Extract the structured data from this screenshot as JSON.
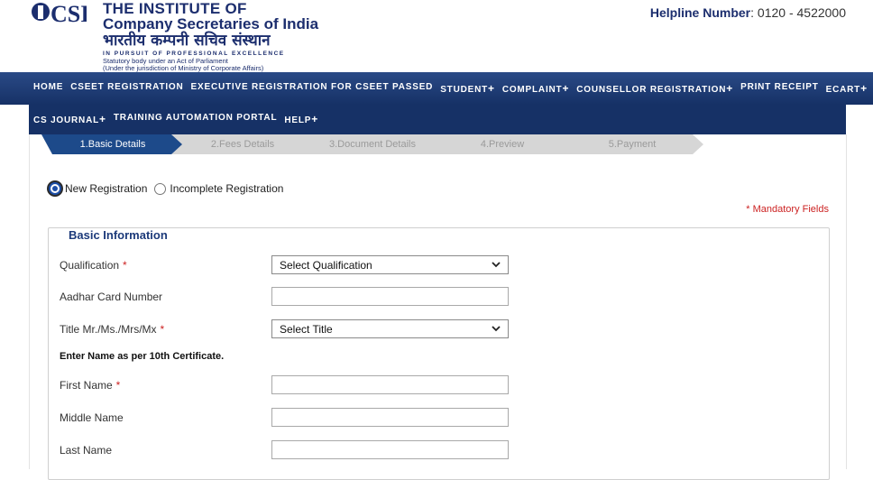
{
  "header": {
    "org_line1": "THE INSTITUTE OF",
    "org_line2": "Company Secretaries of India",
    "org_hindi": "भारतीय कम्पनी सचिव संस्थान",
    "tagline": "IN PURSUIT OF PROFESSIONAL EXCELLENCE",
    "statutory": "Statutory body under an Act of Parliament",
    "jurisdiction": "(Under the jurisdiction of Ministry of Corporate Affairs)",
    "helpline_label": "Helpline Number",
    "helpline_number": ": 0120 - 4522000",
    "logo_icon": "icsi-logo-icon"
  },
  "nav": {
    "row1": [
      {
        "label": "HOME",
        "plus": ""
      },
      {
        "label": "CSEET REGISTRATION",
        "plus": ""
      },
      {
        "label": "EXECUTIVE REGISTRATION FOR CSEET PASSED",
        "plus": ""
      },
      {
        "label": "STUDENT",
        "plus": "+"
      },
      {
        "label": "COMPLAINT",
        "plus": "+"
      },
      {
        "label": "COUNSELLOR REGISTRATION",
        "plus": "+"
      },
      {
        "label": "PRINT RECEIPT",
        "plus": ""
      },
      {
        "label": "ECART",
        "plus": "+"
      }
    ],
    "row2": [
      {
        "label": "CS JOURNAL",
        "plus": "+"
      },
      {
        "label": "TRAINING AUTOMATION PORTAL",
        "plus": ""
      },
      {
        "label": "HELP",
        "plus": "+"
      }
    ]
  },
  "steps": [
    "1.Basic Details",
    "2.Fees Details",
    "3.Document Details",
    "4.Preview",
    "5.Payment"
  ],
  "active_step": 0,
  "registration_type": {
    "options": [
      "New Registration",
      "Incomplete Registration"
    ],
    "selected": "New Registration"
  },
  "mandatory_note": "* Mandatory Fields",
  "section_title": "Basic Information",
  "form": {
    "qualification_label": "Qualification",
    "qualification_value": "Select Qualification",
    "aadhar_label": "Aadhar Card Number",
    "aadhar_value": "",
    "title_label": "Title Mr./Ms./Mrs/Mx",
    "title_value": "Select Title",
    "name_note": "Enter Name as per 10th Certificate.",
    "first_name_label": "First Name",
    "middle_name_label": "Middle Name",
    "last_name_label": "Last Name",
    "required_mark": "*"
  },
  "colors": {
    "nav_bg": "#163166",
    "step_active": "#1d4a8a",
    "step_inactive": "#d6d6d6",
    "brand_text": "#1c2e6e",
    "required": "#cc2222"
  }
}
